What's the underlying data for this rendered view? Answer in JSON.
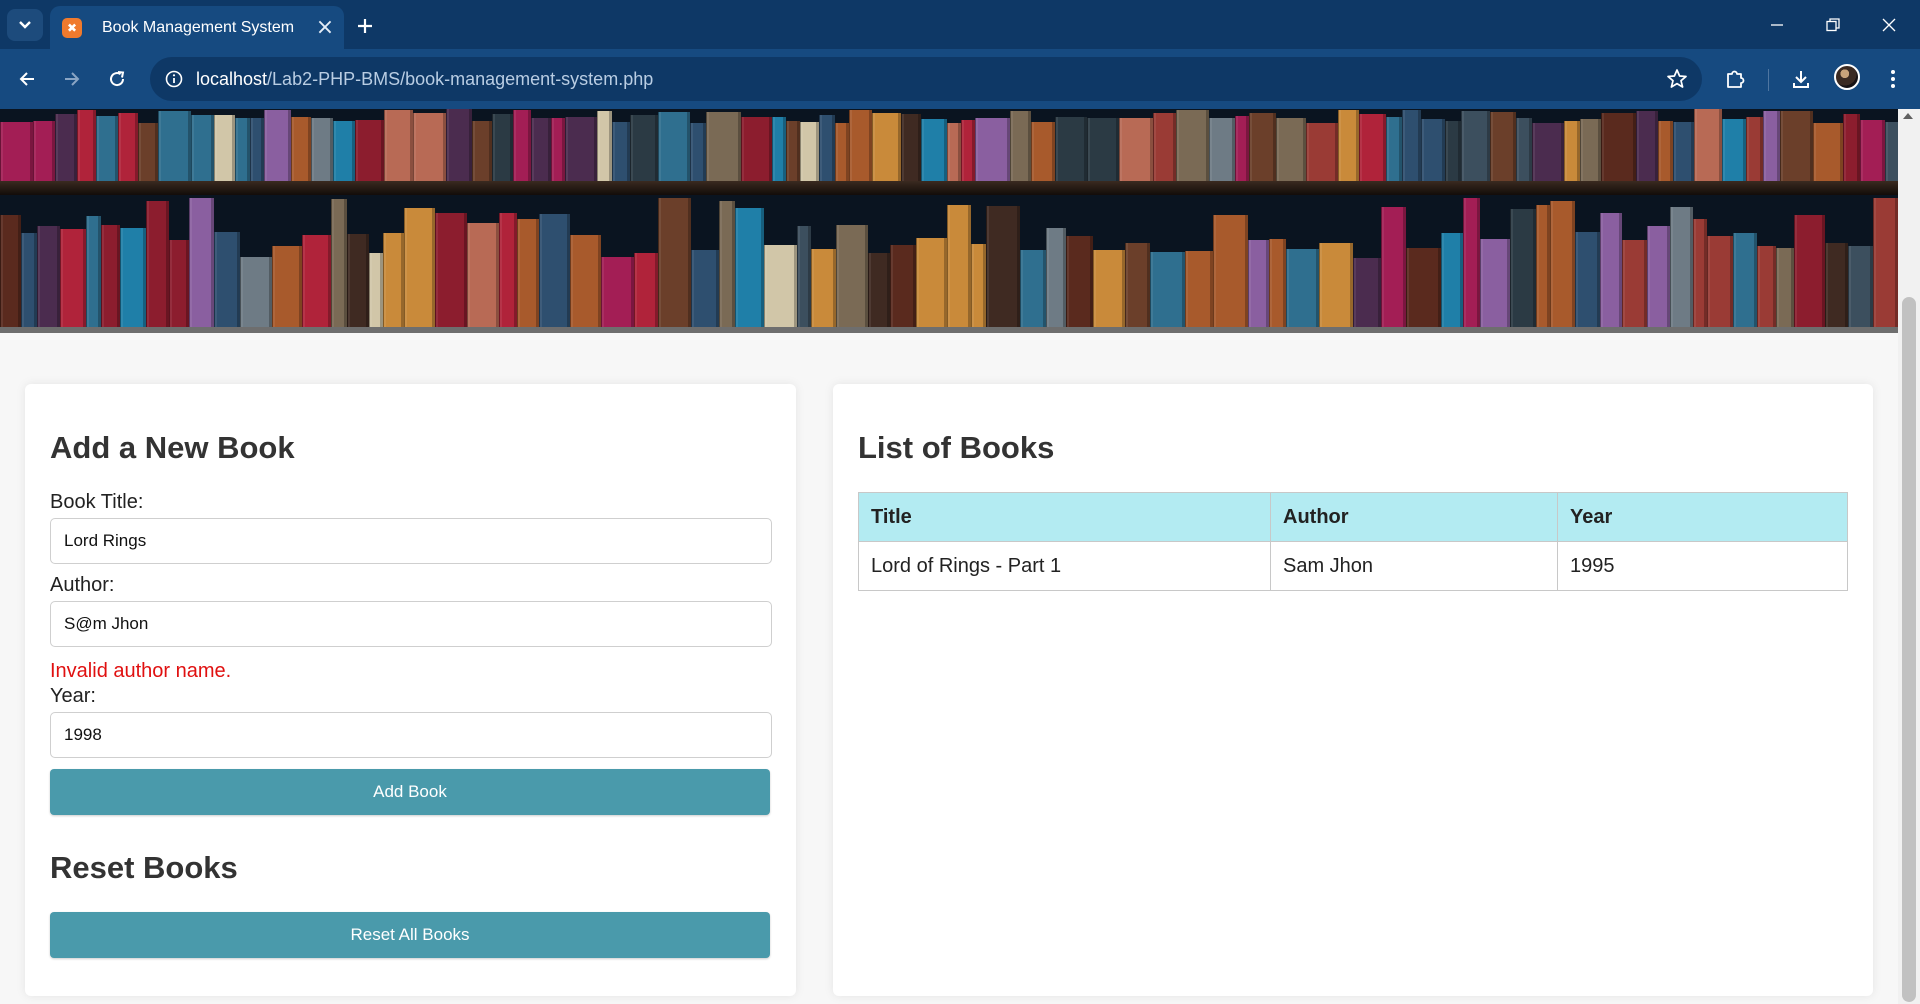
{
  "browser": {
    "tab_title": "Book Management System",
    "favicon_glyph": "✖",
    "url_host": "localhost",
    "url_path": "/Lab2-PHP-BMS/book-management-system.php"
  },
  "colors": {
    "chrome_dark": "#0e3866",
    "chrome_toolbar": "#164a80",
    "button_teal": "#4a9aab",
    "table_header": "#b3ebf2",
    "error_red": "#e01010"
  },
  "add_form": {
    "heading": "Add a New Book",
    "title_label": "Book Title:",
    "title_value": "Lord Rings",
    "author_label": "Author:",
    "author_value": "S@m Jhon",
    "author_error": "Invalid author name.",
    "year_label": "Year:",
    "year_value": "1998",
    "submit_label": "Add Book"
  },
  "reset": {
    "heading": "Reset Books",
    "button_label": "Reset All Books"
  },
  "book_list": {
    "heading": "List of Books",
    "columns": [
      "Title",
      "Author",
      "Year"
    ],
    "rows": [
      [
        "Lord of Rings - Part 1",
        "Sam Jhon",
        "1995"
      ]
    ]
  }
}
